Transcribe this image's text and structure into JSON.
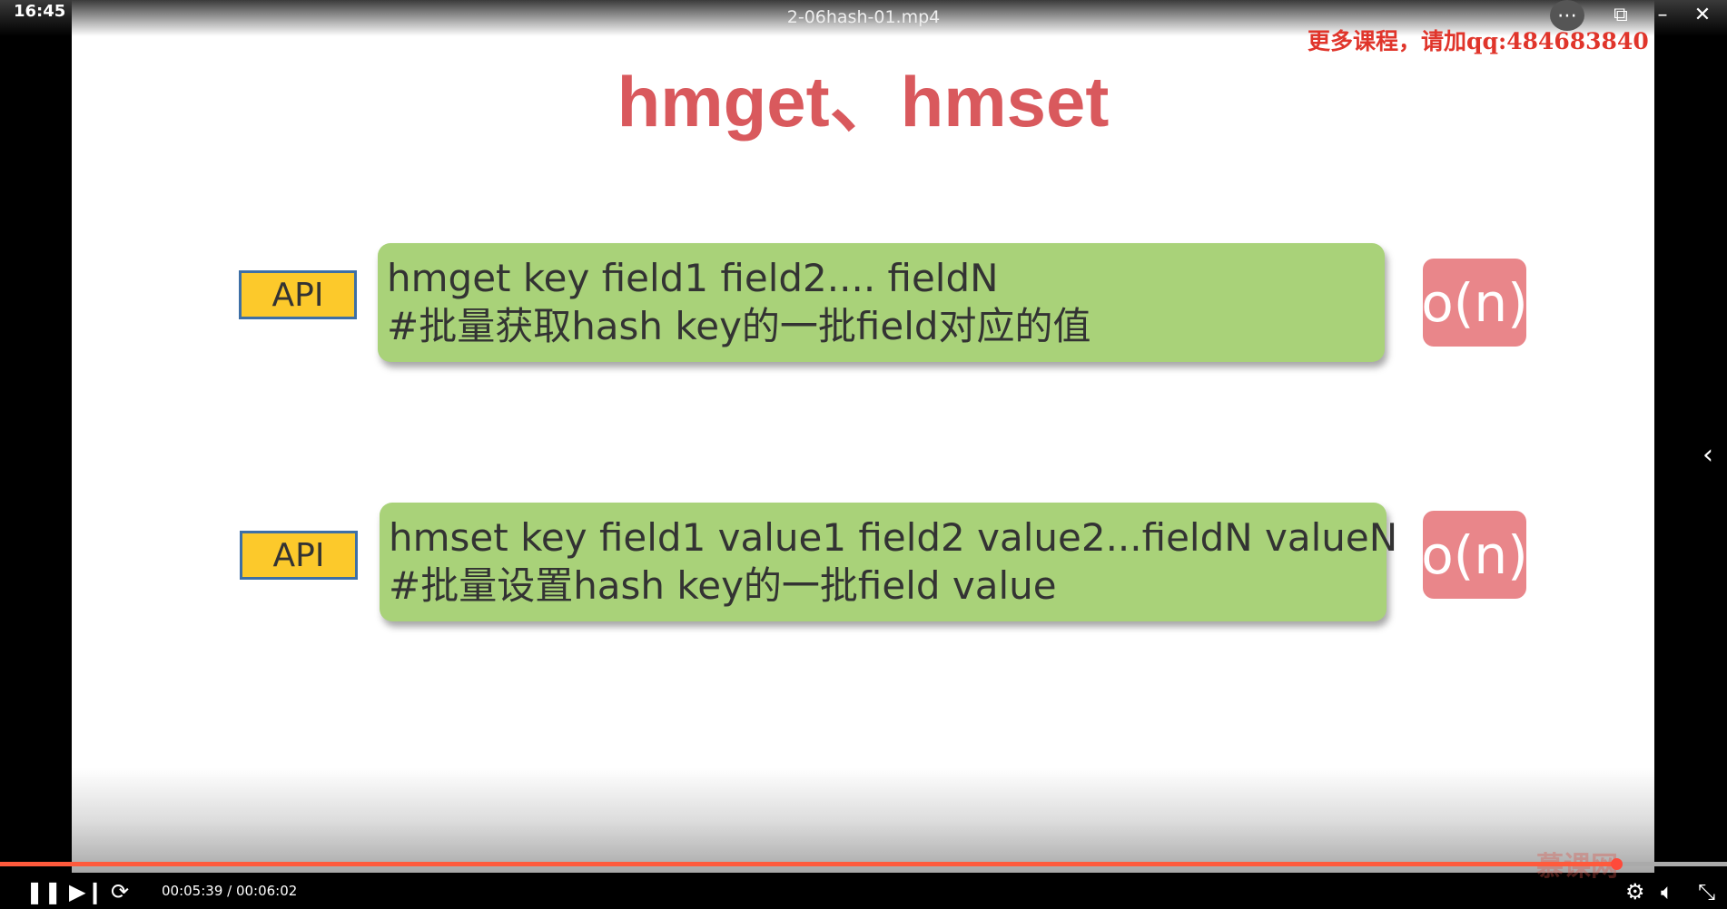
{
  "player": {
    "clock": "16:45",
    "filename": "2-06hash-01.mp4",
    "current_time": "00:05:39",
    "total_time": "00:06:02",
    "time_display": "00:05:39 / 00:06:02",
    "progress_fraction": 0.936,
    "accent": "#ff5a3c"
  },
  "overlay": {
    "ad_text": "更多课程，请加qq:484683840",
    "watermark": "慕课网"
  },
  "slide": {
    "title": "hmget、hmset",
    "rows": [
      {
        "badge": "API",
        "line1": "hmget key field1 field2.... fieldN",
        "line2": "#批量获取hash key的一批field对应的值",
        "complexity": "o(n)"
      },
      {
        "badge": "API",
        "line1": "hmset key field1 value1 field2 value2...fieldN valueN",
        "line2": "#批量设置hash key的一批field value",
        "complexity": "o(n)"
      }
    ]
  }
}
